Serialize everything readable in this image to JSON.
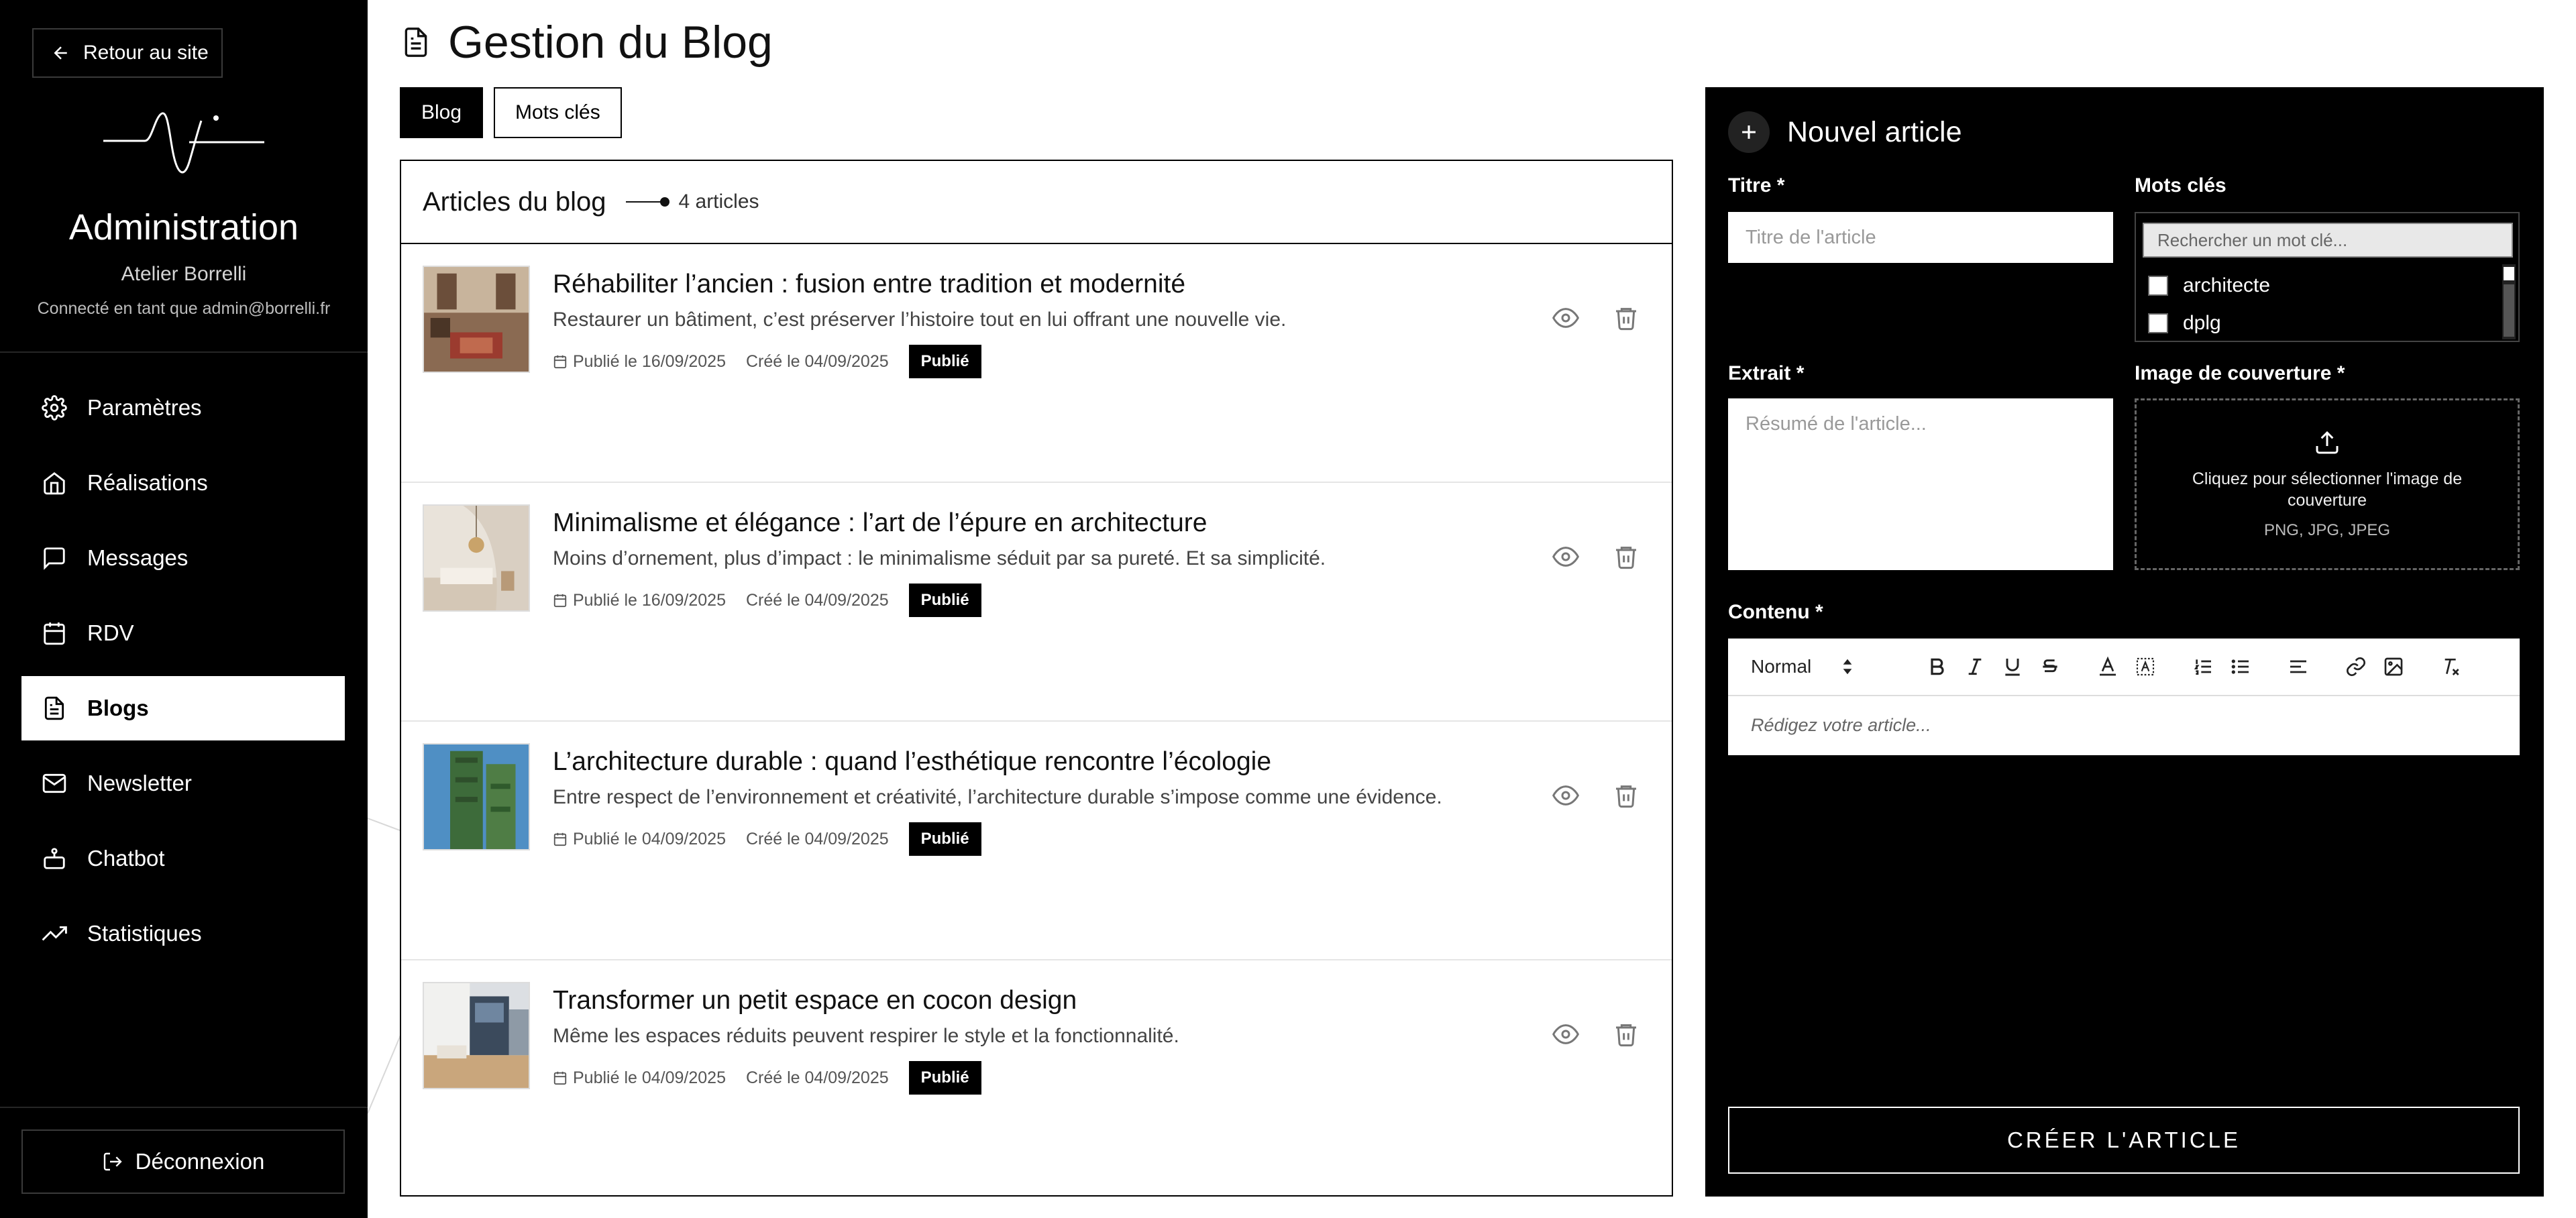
{
  "sidebar": {
    "back_label": "Retour au site",
    "title": "Administration",
    "subtitle": "Atelier Borrelli",
    "connected_as": "Connecté en tant que admin@borrelli.fr",
    "items": [
      {
        "label": "Paramètres",
        "icon": "gear-icon"
      },
      {
        "label": "Réalisations",
        "icon": "home-icon"
      },
      {
        "label": "Messages",
        "icon": "message-icon"
      },
      {
        "label": "RDV",
        "icon": "calendar-icon"
      },
      {
        "label": "Blogs",
        "icon": "document-icon",
        "active": true
      },
      {
        "label": "Newsletter",
        "icon": "mail-icon"
      },
      {
        "label": "Chatbot",
        "icon": "bot-icon"
      },
      {
        "label": "Statistiques",
        "icon": "trending-up-icon"
      }
    ],
    "logout_label": "Déconnexion"
  },
  "header": {
    "title": "Gestion du Blog",
    "tabs": [
      {
        "label": "Blog",
        "active": true
      },
      {
        "label": "Mots clés",
        "active": false
      }
    ]
  },
  "articles_panel": {
    "title": "Articles du blog",
    "count": "4 articles",
    "articles": [
      {
        "title": "Réhabiliter l’ancien : fusion entre tradition et modernité",
        "excerpt": "Restaurer un bâtiment, c’est préserver l’histoire tout en lui offrant une nouvelle vie.",
        "published": "Publié le 16/09/2025",
        "created": "Créé le 04/09/2025",
        "status": "Publié"
      },
      {
        "title": "Minimalisme et élégance : l’art de l’épure en architecture",
        "excerpt": "Moins d’ornement, plus d’impact : le minimalisme séduit par sa pureté. Et sa simplicité.",
        "published": "Publié le 16/09/2025",
        "created": "Créé le 04/09/2025",
        "status": "Publié"
      },
      {
        "title": "L’architecture durable : quand l’esthétique rencontre l’écologie",
        "excerpt": "Entre respect de l’environnement et créativité, l’architecture durable s’impose comme une évidence.",
        "published": "Publié le 04/09/2025",
        "created": "Créé le 04/09/2025",
        "status": "Publié"
      },
      {
        "title": "Transformer un petit espace en cocon design",
        "excerpt": "Même les espaces réduits peuvent respirer le style et la fonctionnalité.",
        "published": "Publié le 04/09/2025",
        "created": "Créé le 04/09/2025",
        "status": "Publié"
      }
    ]
  },
  "form": {
    "heading": "Nouvel article",
    "title_label": "Titre *",
    "title_placeholder": "Titre de l'article",
    "keywords_label": "Mots clés",
    "keywords_search_placeholder": "Rechercher un mot clé...",
    "keywords": [
      "architecte",
      "dplg"
    ],
    "excerpt_label": "Extrait *",
    "excerpt_placeholder": "Résumé de l'article...",
    "cover_label": "Image de couverture *",
    "cover_text": "Cliquez pour sélectionner l'image de couverture",
    "cover_formats": "PNG, JPG, JPEG",
    "content_label": "Contenu *",
    "editor_format": "Normal",
    "editor_placeholder": "Rédigez votre article...",
    "submit_label": "CRÉER L'ARTICLE"
  },
  "colors": {
    "sidebar_bg": "#000000",
    "accent": "#000000",
    "panel_bg": "#000000"
  }
}
